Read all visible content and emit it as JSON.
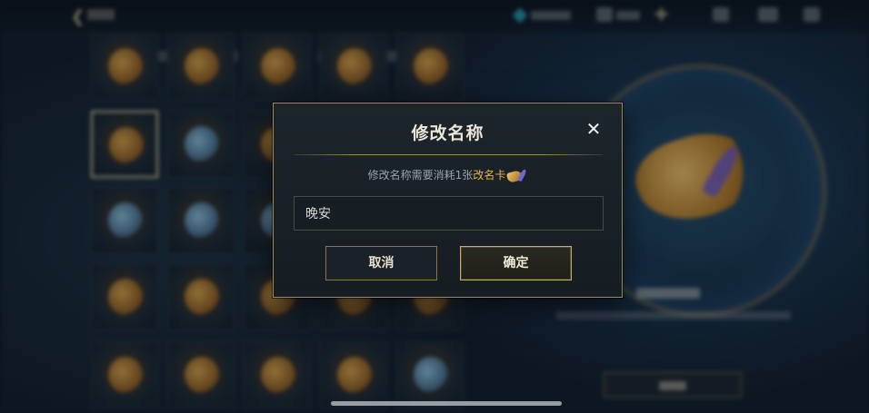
{
  "dialog": {
    "title": "修改名称",
    "close_symbol": "✕",
    "notice_prefix": "修改名称需要消耗1张",
    "notice_item": "改名卡",
    "input_value": "晚安",
    "cancel_label": "取消",
    "confirm_label": "确定"
  },
  "colors": {
    "accent_gold": "#a48a55",
    "highlight": "#e8b53a",
    "dialog_bg": "#1a2128"
  },
  "icons": {
    "back": "chevron-left-icon",
    "close": "close-icon",
    "rename_card": "rename-card-icon"
  }
}
